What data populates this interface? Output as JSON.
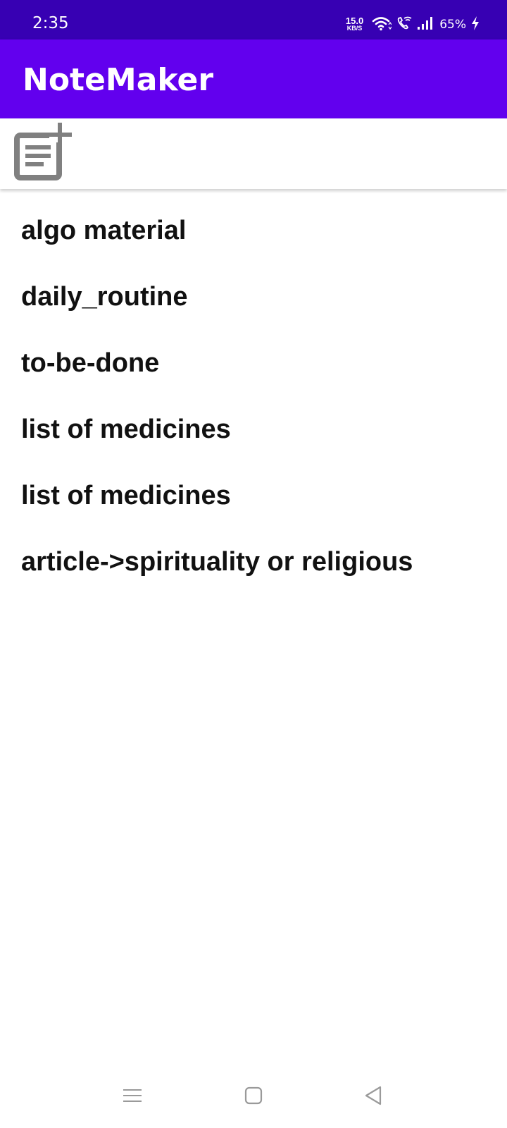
{
  "status_bar": {
    "time": "2:35",
    "net_speed_value": "15.0",
    "net_speed_unit": "KB/S",
    "battery_percent": "65%",
    "icons": [
      "wifi-icon",
      "wifi-calling-icon",
      "signal-icon",
      "charging-icon"
    ]
  },
  "app_bar": {
    "title": "NoteMaker",
    "color": "#6200EE"
  },
  "toolbar": {
    "add_note_icon": "note-add-icon",
    "icon_color": "#808080"
  },
  "notes": [
    {
      "title": "algo material"
    },
    {
      "title": "daily_routine"
    },
    {
      "title": "to-be-done"
    },
    {
      "title": "list of medicines"
    },
    {
      "title": "list of medicines"
    },
    {
      "title": "article->spirituality or religious"
    }
  ],
  "nav_bar": {
    "buttons": [
      "menu-icon",
      "home-icon",
      "back-icon"
    ]
  }
}
